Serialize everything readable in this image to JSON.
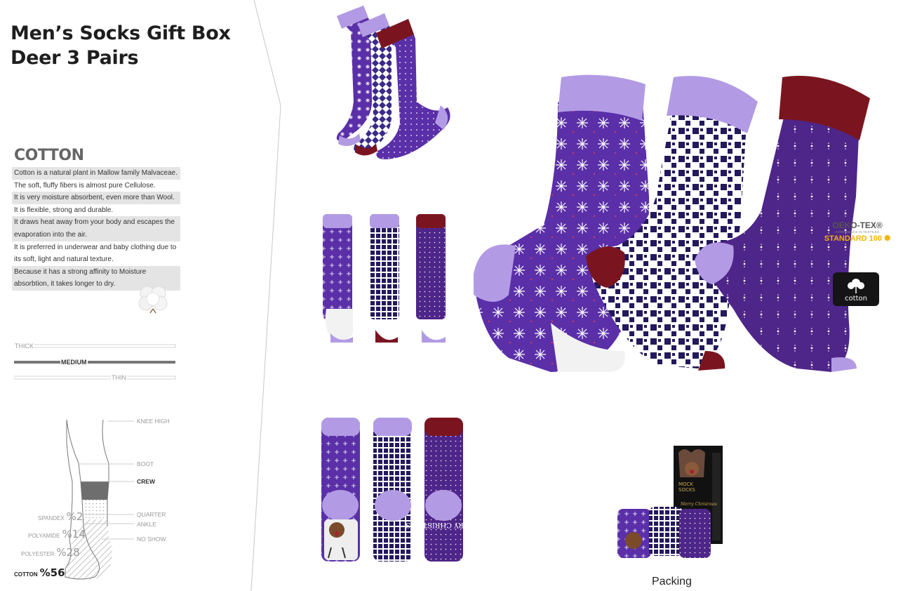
{
  "product": {
    "title_line1": "Men’s Socks Gift Box",
    "title_line2": "Deer 3 Pairs"
  },
  "material": {
    "logo_text": "COTTON",
    "lines": [
      {
        "text": "Cotton is a natural plant in Mallow family Malvaceae.",
        "shaded": true
      },
      {
        "text": "The soft, fluffy fibers is almost pure Cellulose.",
        "shaded": false
      },
      {
        "text": "It is very  moisture absorbent, even more than Wool.",
        "shaded": true
      },
      {
        "text": "It is flexible, strong and durable.",
        "shaded": false
      },
      {
        "text": "It draws heat away from your body and escapes the",
        "shaded": true
      },
      {
        "text": "evaporation  into the air.",
        "shaded": true
      },
      {
        "text": "It is preferred in underwear and baby clothing due to",
        "shaded": false
      },
      {
        "text": "its soft, light and natural texture.",
        "shaded": false
      },
      {
        "text": "Because  it has a strong affinity to Moisture",
        "shaded": true
      },
      {
        "text": "absorbtion, it takes longer to dry.",
        "shaded": true
      }
    ],
    "icon": "cotton-ball-icon"
  },
  "thickness": {
    "options": [
      "THICK",
      "MEDIUM",
      "THIN"
    ],
    "selected": "MEDIUM"
  },
  "length": {
    "options": [
      "KNEE HIGH",
      "BOOT",
      "CREW",
      "QUARTER",
      "ANKLE",
      "NO SHOW"
    ],
    "selected": "CREW"
  },
  "composition": [
    {
      "name": "SPANDEX",
      "value": "%2"
    },
    {
      "name": "POLYAMIDE",
      "value": "%14"
    },
    {
      "name": "POLYESTER",
      "value": "%28"
    },
    {
      "name": "COTTON",
      "value": "%56"
    }
  ],
  "certifications": {
    "oeko_line1": "OEKO-TEX®",
    "oeko_line2": "CONFIDENCE IN TEXTILES",
    "oeko_line3": "STANDARD 100",
    "cotton_badge": "cotton"
  },
  "packing": {
    "label": "Packing",
    "box_lines": [
      "MOCK",
      "SOCKS"
    ],
    "box_script": "Merry Christmas",
    "sock_text": "MERRY CHRISTMAS"
  },
  "colors": {
    "purple": "#5a2fa8",
    "lilac": "#b29be4",
    "navy": "#23195c",
    "maroon": "#7a1520",
    "plum": "#4e2588",
    "gold": "#f0b400"
  }
}
